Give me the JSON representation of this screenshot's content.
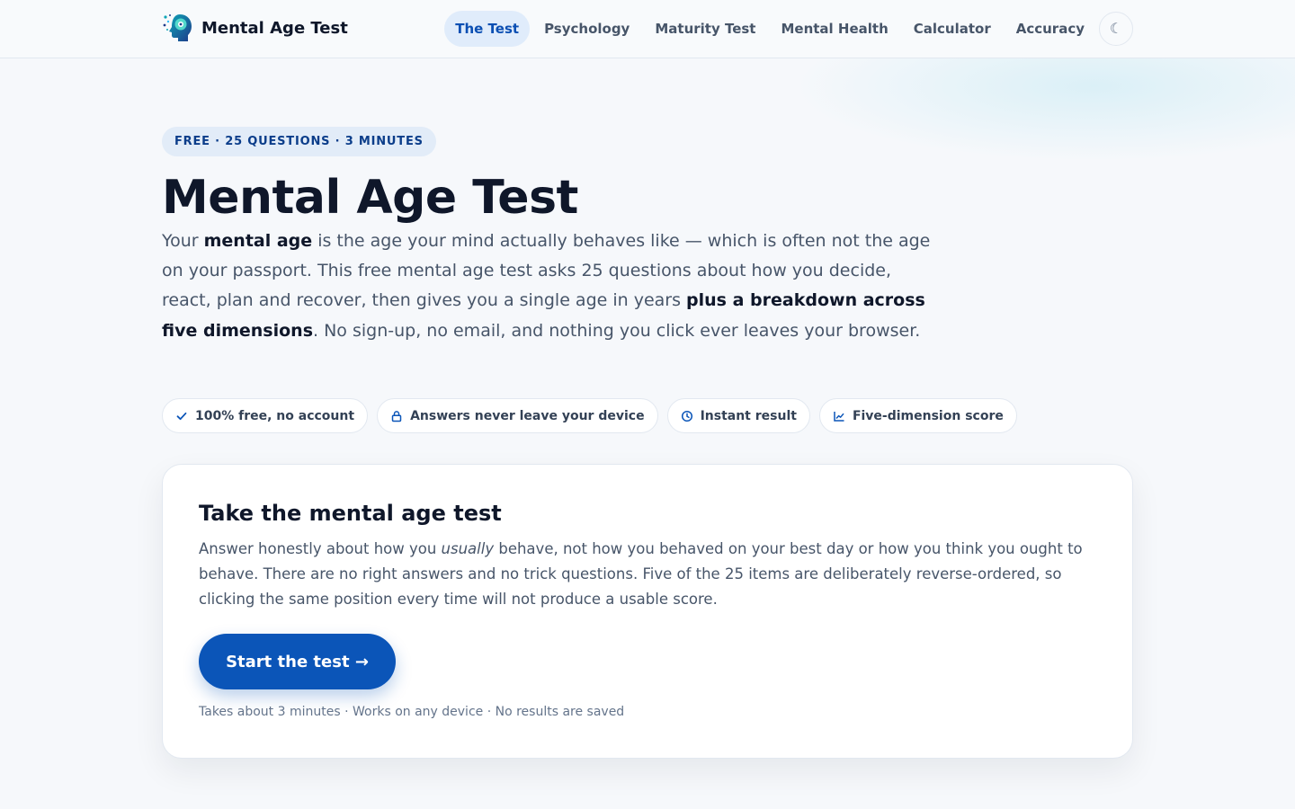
{
  "colors": {
    "accent": "#0b55b8",
    "accent_soft": "#e0ecfb",
    "text_dark": "#0f172a",
    "text_muted": "#475569",
    "background": "#f6f8fb"
  },
  "header": {
    "brand": {
      "name": "Mental Age Test",
      "icon": "brain-head-logo"
    },
    "nav": [
      {
        "label": "The Test",
        "active": true
      },
      {
        "label": "Psychology",
        "active": false
      },
      {
        "label": "Maturity Test",
        "active": false
      },
      {
        "label": "Mental Health",
        "active": false
      },
      {
        "label": "Calculator",
        "active": false
      },
      {
        "label": "Accuracy",
        "active": false
      }
    ],
    "theme_toggle": {
      "glyph": "☾",
      "icon": "moon-icon"
    }
  },
  "hero": {
    "eyebrow": "FREE · 25 QUESTIONS · 3 MINUTES",
    "title": "Mental Age Test",
    "lead": {
      "t1": "Your ",
      "b1": "mental age",
      "t2": " is the age your mind actually behaves like — which is often not the age on your passport. This free mental age test asks 25 questions about how you decide, react, plan and recover, then gives you a single age in years ",
      "b2": "plus a breakdown across five dimensions",
      "t3": ". No sign-up, no email, and nothing you click ever leaves your browser."
    },
    "pills": [
      {
        "label": "100% free, no account",
        "icon": "check-icon"
      },
      {
        "label": "Answers never leave your device",
        "icon": "lock-icon"
      },
      {
        "label": "Instant result",
        "icon": "clock-icon"
      },
      {
        "label": "Five-dimension score",
        "icon": "chart-icon"
      }
    ]
  },
  "card": {
    "title": "Take the mental age test",
    "text": {
      "t1": "Answer honestly about how you ",
      "em": "usually",
      "t2": " behave, not how you behaved on your best day or how you think you ought to behave. There are no right answers and no trick questions. Five of the 25 items are deliberately reverse-ordered, so clicking the same position every time will not produce a usable score."
    },
    "button_label": "Start the test →",
    "note": "Takes about 3 minutes · Works on any device · No results are saved"
  }
}
